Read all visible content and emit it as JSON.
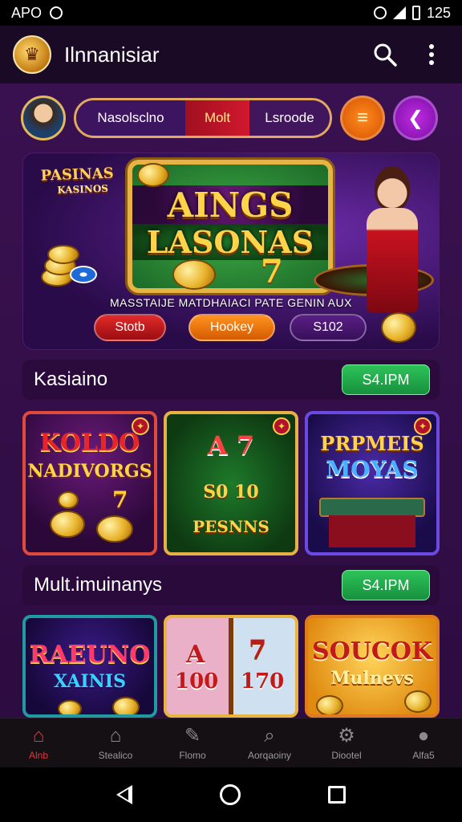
{
  "status_bar": {
    "left_text": "APO",
    "time": "125"
  },
  "app_bar": {
    "title": "Ilnnanisiar",
    "search_icon": "search-icon",
    "menu_icon": "more-vert-icon"
  },
  "filters": {
    "segments": [
      "Nasolsclno",
      "Molt",
      "Lsroode"
    ]
  },
  "banner": {
    "tag_line1": "PASINAS",
    "tag_line2": "KASINOS",
    "title_line1": "AINGS",
    "title_line2": "LASONAS",
    "subtitle": "MASSTAIJE MATDHAIACI PATE GENIN AUX",
    "buttons": [
      "Stotb",
      "Hookey",
      "S102"
    ]
  },
  "sections": [
    {
      "title": "Kasiaino",
      "button": "S4.IPM",
      "tiles": [
        {
          "line1": "KOLDO",
          "line2": "NADIVORGS"
        },
        {
          "line1": "A 7",
          "line2": "S0 10",
          "line3": "PESNNS"
        },
        {
          "line1": "PRPMEIS",
          "line2": "MOYAS"
        }
      ]
    },
    {
      "title": "Mult.imuinanys",
      "button": "S4.IPM",
      "tiles": [
        {
          "line1": "RAEUNO",
          "line2": "XAINIS"
        },
        {
          "line1": "A",
          "line2": "100",
          "line3": "170"
        },
        {
          "line1": "SOUCOK",
          "line2": "Mulnevs"
        }
      ]
    }
  ],
  "bottom_nav": [
    "Alnb",
    "Stealico",
    "Flomo",
    "Aorqaoiny",
    "Diootel",
    "Alfa5"
  ],
  "colors": {
    "accent": "#e8343a",
    "green": "#2ec35a",
    "orange": "#ff8a1f",
    "purple": "#c02be0",
    "gold": "#ffd34a"
  }
}
